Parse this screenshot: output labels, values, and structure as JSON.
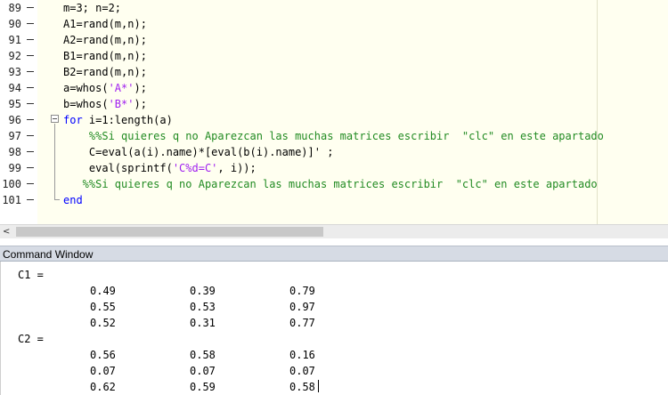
{
  "editor": {
    "lines": [
      {
        "num": "89",
        "code": [
          {
            "t": "m=3; n=2;",
            "c": "plain"
          }
        ]
      },
      {
        "num": "90",
        "code": [
          {
            "t": "A1=rand(m,n);",
            "c": "plain"
          }
        ]
      },
      {
        "num": "91",
        "code": [
          {
            "t": "A2=rand(m,n);",
            "c": "plain"
          }
        ]
      },
      {
        "num": "92",
        "code": [
          {
            "t": "B1=rand(m,n);",
            "c": "plain"
          }
        ]
      },
      {
        "num": "93",
        "code": [
          {
            "t": "B2=rand(m,n);",
            "c": "plain"
          }
        ]
      },
      {
        "num": "94",
        "code": [
          {
            "t": "a=whos(",
            "c": "plain"
          },
          {
            "t": "'A*'",
            "c": "str"
          },
          {
            "t": ");",
            "c": "plain"
          }
        ]
      },
      {
        "num": "95",
        "code": [
          {
            "t": "b=whos(",
            "c": "plain"
          },
          {
            "t": "'B*'",
            "c": "str"
          },
          {
            "t": ");",
            "c": "plain"
          }
        ]
      },
      {
        "num": "96",
        "code": [
          {
            "t": "for",
            "c": "kw"
          },
          {
            "t": " i=1:length(a)",
            "c": "plain"
          }
        ]
      },
      {
        "num": "97",
        "code": [
          {
            "t": "    %%Si quieres q no Aparezcan las muchas matrices escribir  \"clc\" en este apartado",
            "c": "cmt"
          }
        ]
      },
      {
        "num": "98",
        "code": [
          {
            "t": "    C=eval(a(i).name)*[eval(b(i).name)]' ;",
            "c": "plain"
          }
        ]
      },
      {
        "num": "99",
        "code": [
          {
            "t": "    eval(sprintf(",
            "c": "plain"
          },
          {
            "t": "'C%d=C'",
            "c": "str"
          },
          {
            "t": ", i));",
            "c": "plain"
          }
        ]
      },
      {
        "num": "100",
        "code": [
          {
            "t": "   %%Si quieres q no Aparezcan las muchas matrices escribir  \"clc\" en este apartado",
            "c": "cmt"
          }
        ]
      },
      {
        "num": "101",
        "code": [
          {
            "t": "end",
            "c": "kw"
          }
        ]
      }
    ]
  },
  "scrollbar": {
    "left_arrow": "<"
  },
  "command_window": {
    "title": "Command Window",
    "outputs": [
      {
        "label": "C1 =",
        "rows": [
          [
            "0.49",
            "0.39",
            "0.79"
          ],
          [
            "0.55",
            "0.53",
            "0.97"
          ],
          [
            "0.52",
            "0.31",
            "0.77"
          ]
        ]
      },
      {
        "label": "C2 =",
        "rows": [
          [
            "0.56",
            "0.58",
            "0.16"
          ],
          [
            "0.07",
            "0.07",
            "0.07"
          ],
          [
            "0.62",
            "0.59",
            "0.58"
          ]
        ]
      }
    ]
  }
}
